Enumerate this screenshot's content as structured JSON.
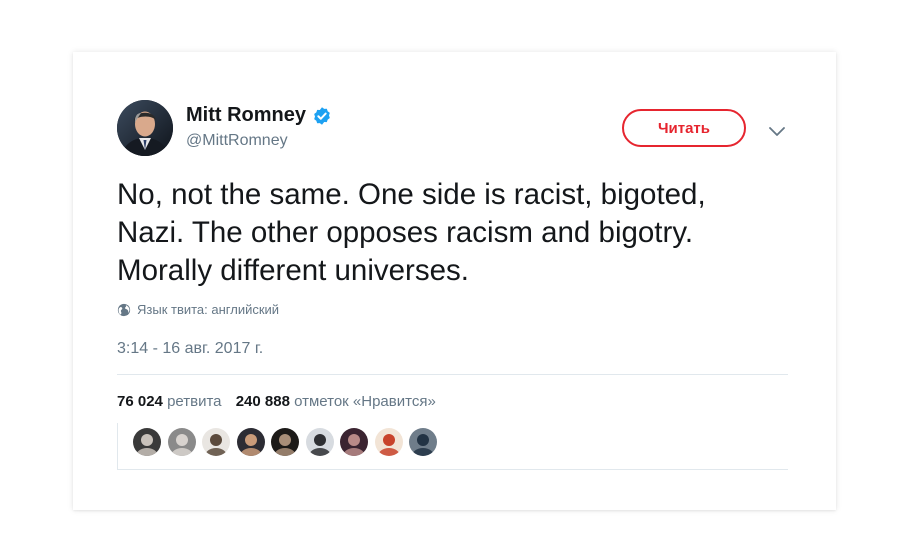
{
  "tweet": {
    "author_name": "Mitt Romney",
    "author_handle": "@MittRomney",
    "verified": true,
    "follow_label": "Читать",
    "text": "No, not the same. One side is racist, bigoted,\nNazi. The other opposes racism and bigotry.\nMorally different universes.",
    "language_label": "Язык твита: английский",
    "timestamp": "3:14 - 16 авг. 2017 г.",
    "retweets_count": "76 024",
    "retweets_label": "ретвита",
    "likes_count": "240 888",
    "likes_label": "отметок «Нравится»"
  },
  "icons": {
    "verified": "verified-badge-icon",
    "menu": "chevron-down-icon",
    "language": "globe-icon"
  },
  "colors": {
    "follow_accent": "#e6252f",
    "verified_blue": "#1da1f2",
    "text_primary": "#14171a",
    "text_secondary": "#657786",
    "divider": "#e1e8ed"
  },
  "likers": [
    {
      "id": "liker-1",
      "bg": "#3a3a3a",
      "fg": "#c9c2bb"
    },
    {
      "id": "liker-2",
      "bg": "#8a8a8a",
      "fg": "#d8d3cf"
    },
    {
      "id": "liker-3",
      "bg": "#e9e6e2",
      "fg": "#5b4a3c"
    },
    {
      "id": "liker-4",
      "bg": "#2c2c34",
      "fg": "#c99b7a"
    },
    {
      "id": "liker-5",
      "bg": "#1c1a18",
      "fg": "#a88e78"
    },
    {
      "id": "liker-6",
      "bg": "#d7dbe0",
      "fg": "#2e2f33"
    },
    {
      "id": "liker-7",
      "bg": "#3b2431",
      "fg": "#b98a88"
    },
    {
      "id": "liker-8",
      "bg": "#f2e4d6",
      "fg": "#c8432b"
    },
    {
      "id": "liker-9",
      "bg": "#6f7d8a",
      "fg": "#223344"
    }
  ]
}
